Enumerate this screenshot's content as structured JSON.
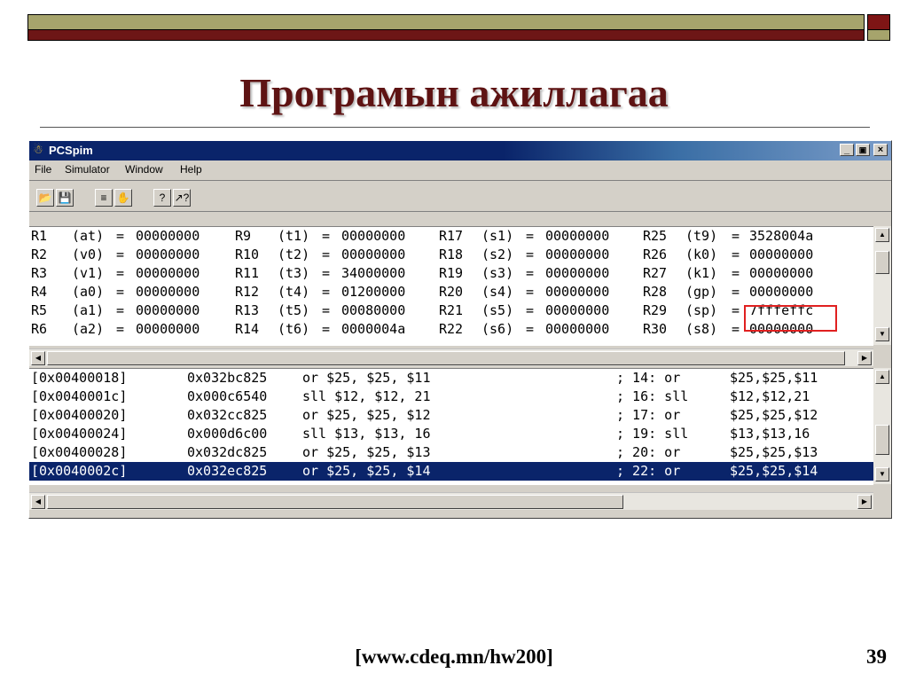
{
  "slide": {
    "title": "Програмын ажиллагаа",
    "footer_source": "[www.cdeq.mn/hw200]",
    "page_number": "39"
  },
  "window": {
    "title": "PCSpim",
    "controls": {
      "minimize": "_",
      "maximize": "▣",
      "close": "×"
    },
    "menu": [
      {
        "label": "File"
      },
      {
        "label": "Simulator"
      },
      {
        "label": "Window"
      },
      {
        "label": "Help"
      }
    ],
    "toolbar_icons": [
      "open-icon",
      "save-icon",
      "run-icon",
      "stop-icon",
      "help-icon",
      "context-help-icon"
    ]
  },
  "registers": {
    "rows": [
      [
        {
          "reg": "R1",
          "alias": "(at)",
          "value": "00000000"
        },
        {
          "reg": "R9",
          "alias": "(t1)",
          "value": "00000000"
        },
        {
          "reg": "R17",
          "alias": "(s1)",
          "value": "00000000"
        },
        {
          "reg": "R25",
          "alias": "(t9)",
          "value": "3528004a"
        }
      ],
      [
        {
          "reg": "R2",
          "alias": "(v0)",
          "value": "00000000"
        },
        {
          "reg": "R10",
          "alias": "(t2)",
          "value": "00000000"
        },
        {
          "reg": "R18",
          "alias": "(s2)",
          "value": "00000000"
        },
        {
          "reg": "R26",
          "alias": "(k0)",
          "value": "00000000"
        }
      ],
      [
        {
          "reg": "R3",
          "alias": "(v1)",
          "value": "00000000"
        },
        {
          "reg": "R11",
          "alias": "(t3)",
          "value": "34000000"
        },
        {
          "reg": "R19",
          "alias": "(s3)",
          "value": "00000000"
        },
        {
          "reg": "R27",
          "alias": "(k1)",
          "value": "00000000"
        }
      ],
      [
        {
          "reg": "R4",
          "alias": "(a0)",
          "value": "00000000"
        },
        {
          "reg": "R12",
          "alias": "(t4)",
          "value": "01200000"
        },
        {
          "reg": "R20",
          "alias": "(s4)",
          "value": "00000000"
        },
        {
          "reg": "R28",
          "alias": "(gp)",
          "value": "00000000"
        }
      ],
      [
        {
          "reg": "R5",
          "alias": "(a1)",
          "value": "00000000"
        },
        {
          "reg": "R13",
          "alias": "(t5)",
          "value": "00080000"
        },
        {
          "reg": "R21",
          "alias": "(s5)",
          "value": "00000000"
        },
        {
          "reg": "R29",
          "alias": "(sp)",
          "value": "7fffeffc"
        }
      ],
      [
        {
          "reg": "R6",
          "alias": "(a2)",
          "value": "00000000"
        },
        {
          "reg": "R14",
          "alias": "(t6)",
          "value": "0000004a"
        },
        {
          "reg": "R22",
          "alias": "(s6)",
          "value": "00000000"
        },
        {
          "reg": "R30",
          "alias": "(s8)",
          "value": "00000000"
        }
      ]
    ]
  },
  "text_segment": {
    "selected_index": 5,
    "rows": [
      {
        "addr": "[0x00400018]",
        "code": "0x032bc825",
        "asm": "or $25, $25, $11",
        "line": "; 14: or",
        "src": "$25,$25,$11"
      },
      {
        "addr": "[0x0040001c]",
        "code": "0x000c6540",
        "asm": "sll $12, $12, 21",
        "line": "; 16: sll",
        "src": "$12,$12,21"
      },
      {
        "addr": "[0x00400020]",
        "code": "0x032cc825",
        "asm": "or $25, $25, $12",
        "line": "; 17: or",
        "src": "$25,$25,$12"
      },
      {
        "addr": "[0x00400024]",
        "code": "0x000d6c00",
        "asm": "sll $13, $13, 16",
        "line": "; 19: sll",
        "src": "$13,$13,16"
      },
      {
        "addr": "[0x00400028]",
        "code": "0x032dc825",
        "asm": "or $25, $25, $13",
        "line": "; 20: or",
        "src": "$25,$25,$13"
      },
      {
        "addr": "[0x0040002c]",
        "code": "0x032ec825",
        "asm": "or $25, $25, $14",
        "line": "; 22: or",
        "src": "$25,$25,$14"
      }
    ]
  },
  "colors": {
    "title": "#5e1313",
    "selection": "#0a246a",
    "annotation": "#e02020"
  }
}
